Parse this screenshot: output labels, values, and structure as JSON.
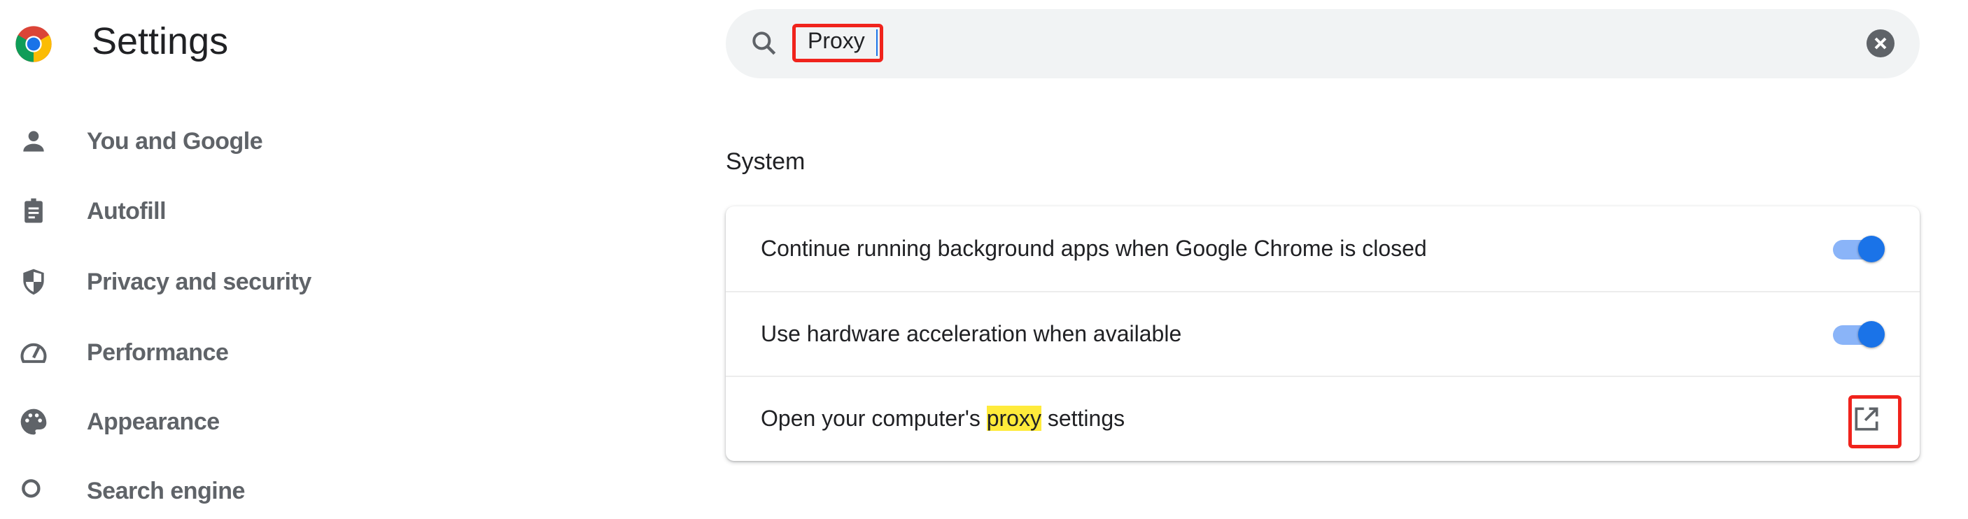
{
  "header": {
    "title": "Settings",
    "logo": "chrome-logo"
  },
  "sidebar": {
    "items": [
      {
        "label": "You and Google",
        "icon": "person-icon"
      },
      {
        "label": "Autofill",
        "icon": "clipboard-icon"
      },
      {
        "label": "Privacy and security",
        "icon": "shield-icon"
      },
      {
        "label": "Performance",
        "icon": "speedometer-icon"
      },
      {
        "label": "Appearance",
        "icon": "palette-icon"
      },
      {
        "label": "Search engine",
        "icon": "search-icon"
      }
    ]
  },
  "search": {
    "value": "Proxy",
    "icon": "search-icon",
    "clear_icon": "clear-icon"
  },
  "main": {
    "section_title": "System",
    "rows": [
      {
        "label": "Continue running background apps when Google Chrome is closed",
        "control": "toggle",
        "on": true
      },
      {
        "label": "Use hardware acceleration when available",
        "control": "toggle",
        "on": true
      },
      {
        "label_before": "Open your computer's ",
        "highlight": "proxy",
        "label_after": " settings",
        "control": "open-in-new-icon"
      }
    ]
  },
  "colors": {
    "accent": "#1a73e8",
    "highlight": "#ffeb3b",
    "annotation_box": "#f0231c"
  }
}
